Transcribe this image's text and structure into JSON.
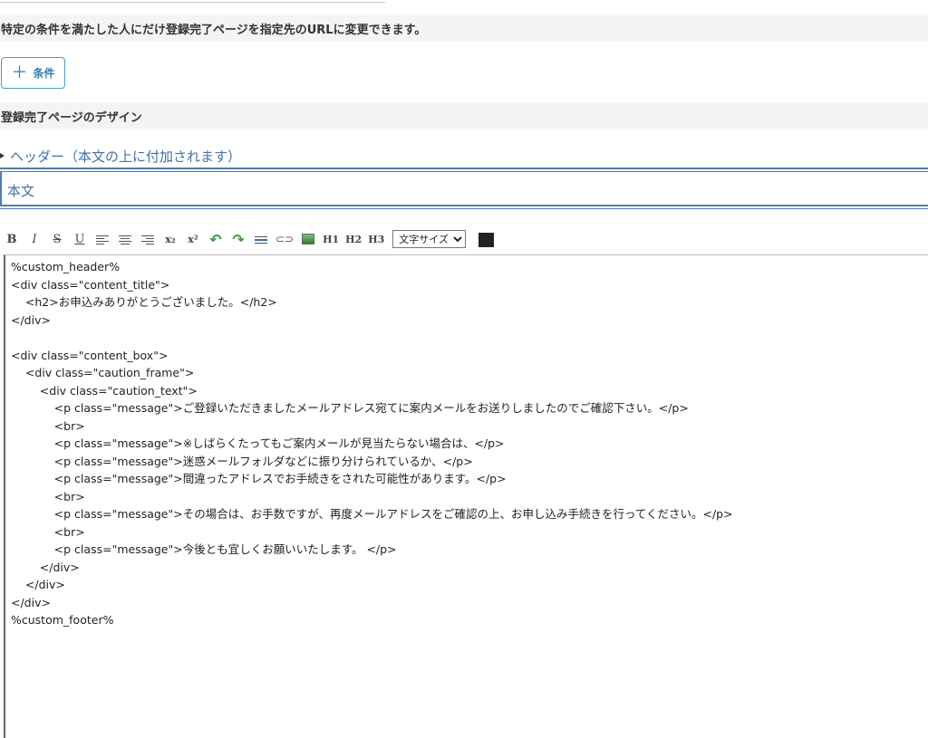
{
  "condition_notice": "特定の条件を満たした人にだけ登録完了ページを指定先のURLに変更できます。",
  "condition_button": {
    "icon": "plus-icon",
    "label": "条件"
  },
  "design_heading": "登録完了ページのデザイン",
  "header_toggle": "ヘッダー（本文の上に付加されます）",
  "body_label": "本文",
  "toolbar": {
    "bold": "B",
    "italic": "I",
    "strike": "S",
    "underline": "U",
    "subscript": "x₂",
    "superscript": "x²",
    "h1": "H1",
    "h2": "H2",
    "h3": "H3",
    "font_size": "文字サイズ",
    "text_color": "#222222"
  },
  "editor": {
    "lines": [
      "%custom_header%",
      "<div class=\"content_title\">",
      "    <h2>お申込みありがとうございました。</h2>",
      "</div>",
      "",
      "<div class=\"content_box\">",
      "    <div class=\"caution_frame\">",
      "        <div class=\"caution_text\">",
      "            <p class=\"message\">ご登録いただきましたメールアドレス宛てに案内メールをお送りしましたのでご確認下さい。</p>",
      "            <br>",
      "            <p class=\"message\">※しばらくたってもご案内メールが見当たらない場合は、</p>",
      "            <p class=\"message\">迷惑メールフォルダなどに振り分けられているか、</p>",
      "            <p class=\"message\">間違ったアドレスでお手続きをされた可能性があります。</p>",
      "            <br>",
      "            <p class=\"message\">その場合は、お手数ですが、再度メールアドレスをご確認の上、お申し込み手続きを行ってください。</p>",
      "            <br>",
      "            <p class=\"message\">今後とも宜しくお願いいたします。 </p>",
      "        </div>",
      "    </div>",
      "</div>",
      "%custom_footer%"
    ]
  }
}
